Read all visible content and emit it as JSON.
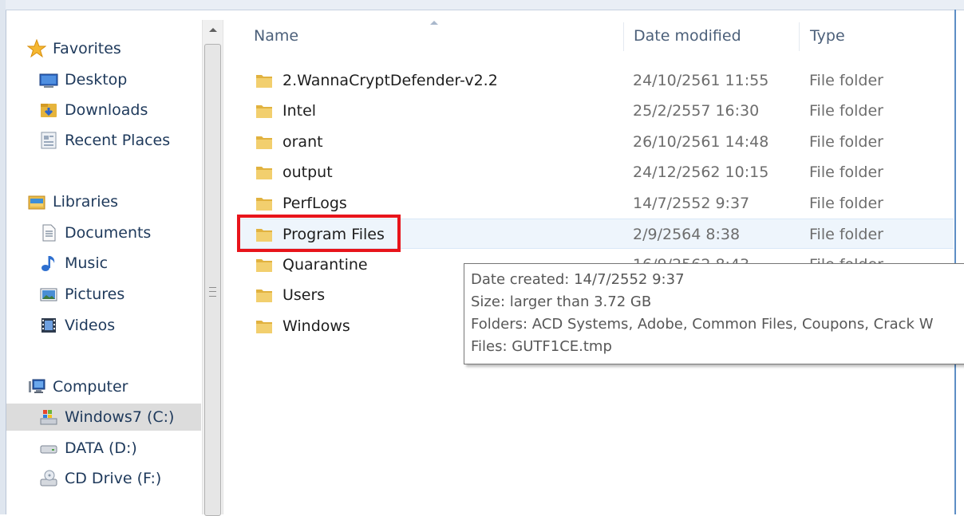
{
  "navigation": {
    "favorites": "Favorites",
    "desktop": "Desktop",
    "downloads": "Downloads",
    "recent_places": "Recent Places",
    "libraries": "Libraries",
    "documents": "Documents",
    "music": "Music",
    "pictures": "Pictures",
    "videos": "Videos",
    "computer": "Computer",
    "drive_c": "Windows7 (C:)",
    "drive_d": "DATA (D:)",
    "drive_f": "CD Drive (F:)"
  },
  "columns": {
    "name": "Name",
    "date_modified": "Date modified",
    "type": "Type"
  },
  "files": [
    {
      "name": "2.WannaCryptDefender-v2.2",
      "date": "24/10/2561 11:55",
      "type": "File folder"
    },
    {
      "name": "Intel",
      "date": "25/2/2557 16:30",
      "type": "File folder"
    },
    {
      "name": "orant",
      "date": "26/10/2561 14:48",
      "type": "File folder"
    },
    {
      "name": "output",
      "date": "24/12/2562 10:15",
      "type": "File folder"
    },
    {
      "name": "PerfLogs",
      "date": "14/7/2552 9:37",
      "type": "File folder"
    },
    {
      "name": "Program Files",
      "date": "2/9/2564 8:38",
      "type": "File folder"
    },
    {
      "name": "Quarantine",
      "date": "16/9/2562 8:43",
      "type": "File folder"
    },
    {
      "name": "Users",
      "date": "",
      "type": ""
    },
    {
      "name": "Windows",
      "date": "",
      "type": ""
    }
  ],
  "tooltip": {
    "date_created": "Date created: 14/7/2552 9:37",
    "size": "Size: larger than 3.72 GB",
    "folders": "Folders: ACD Systems, Adobe, Common Files, Coupons, Crack W",
    "files": "Files: GUTF1CE.tmp"
  },
  "colors": {
    "highlight_box": "#e8141b",
    "selected_nav": "#dcdcdc",
    "hover_row": "#eef5fc"
  },
  "icons": {
    "favorites": "star-icon",
    "desktop": "desktop-icon",
    "downloads": "downloads-folder-icon",
    "recent_places": "recent-places-icon",
    "libraries": "libraries-icon",
    "documents": "document-icon",
    "music": "music-note-icon",
    "pictures": "pictures-icon",
    "videos": "film-icon",
    "computer": "computer-icon",
    "drive_c": "windows-drive-icon",
    "drive_d": "hard-drive-icon",
    "drive_f": "cd-drive-icon",
    "folder": "folder-icon"
  }
}
